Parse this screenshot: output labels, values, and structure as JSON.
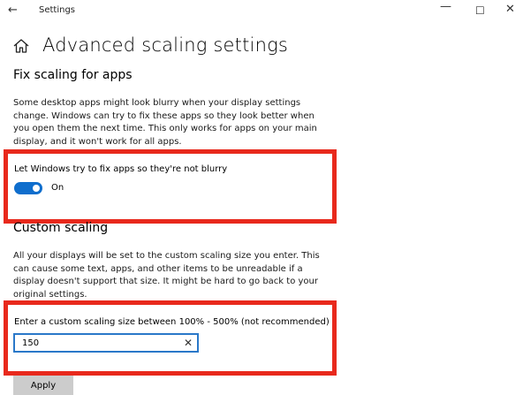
{
  "window": {
    "title": "Settings",
    "back_glyph": "←",
    "minimize_glyph": "—",
    "maximize_glyph": "☐",
    "close_glyph": "✕"
  },
  "header": {
    "title": "Advanced scaling settings",
    "icon": "home-icon"
  },
  "fix_scaling": {
    "title": "Fix scaling for apps",
    "description": "Some desktop apps might look blurry when your display settings change. Windows can try to fix these apps so they look better when you open them the next time. This only works for apps on your main display, and it won't work for all apps.",
    "toggle_label": "Let Windows try to fix apps so they're not blurry",
    "toggle_state": "On",
    "toggle_on": true
  },
  "custom_scaling": {
    "title": "Custom scaling",
    "description": "All your displays will be set to the custom scaling size you enter. This can cause some text, apps, and other items to be unreadable if a display doesn't support that size. It might be hard to go back to your original settings.",
    "input_label": "Enter a custom scaling size between 100% - 500% (not recommended)",
    "input_value": "150",
    "clear_glyph": "✕",
    "apply_label": "Apply"
  },
  "colors": {
    "accent": "#0f6ecd",
    "highlight_border": "#e8291c",
    "input_border": "#2a78c9",
    "button_bg": "#cccccc"
  }
}
